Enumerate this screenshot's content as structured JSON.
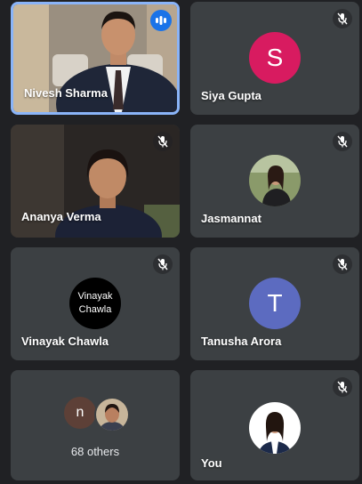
{
  "participants": [
    {
      "name": "Nivesh Sharma",
      "state": "speaking",
      "tile": "video"
    },
    {
      "name": "Siya Gupta",
      "state": "muted",
      "avatar_letter": "S",
      "avatar_color": "#d81b60"
    },
    {
      "name": "Ananya Verma",
      "state": "muted",
      "tile": "video"
    },
    {
      "name": "Jasmannat",
      "state": "muted",
      "tile": "photo"
    },
    {
      "name": "Vinayak Chawla",
      "state": "muted",
      "avatar_text_line1": "Vinayak",
      "avatar_text_line2": "Chawla"
    },
    {
      "name": "Tanusha Arora",
      "state": "muted",
      "avatar_letter": "T",
      "avatar_color": "#5c6bc0"
    }
  ],
  "others": {
    "label": "68 others",
    "avatar_letter": "n"
  },
  "self": {
    "name": "You"
  },
  "colors": {
    "background": "#202124",
    "tile": "#3c4043",
    "active_border": "#8ab4f8",
    "speaking": "#1a73e8"
  }
}
